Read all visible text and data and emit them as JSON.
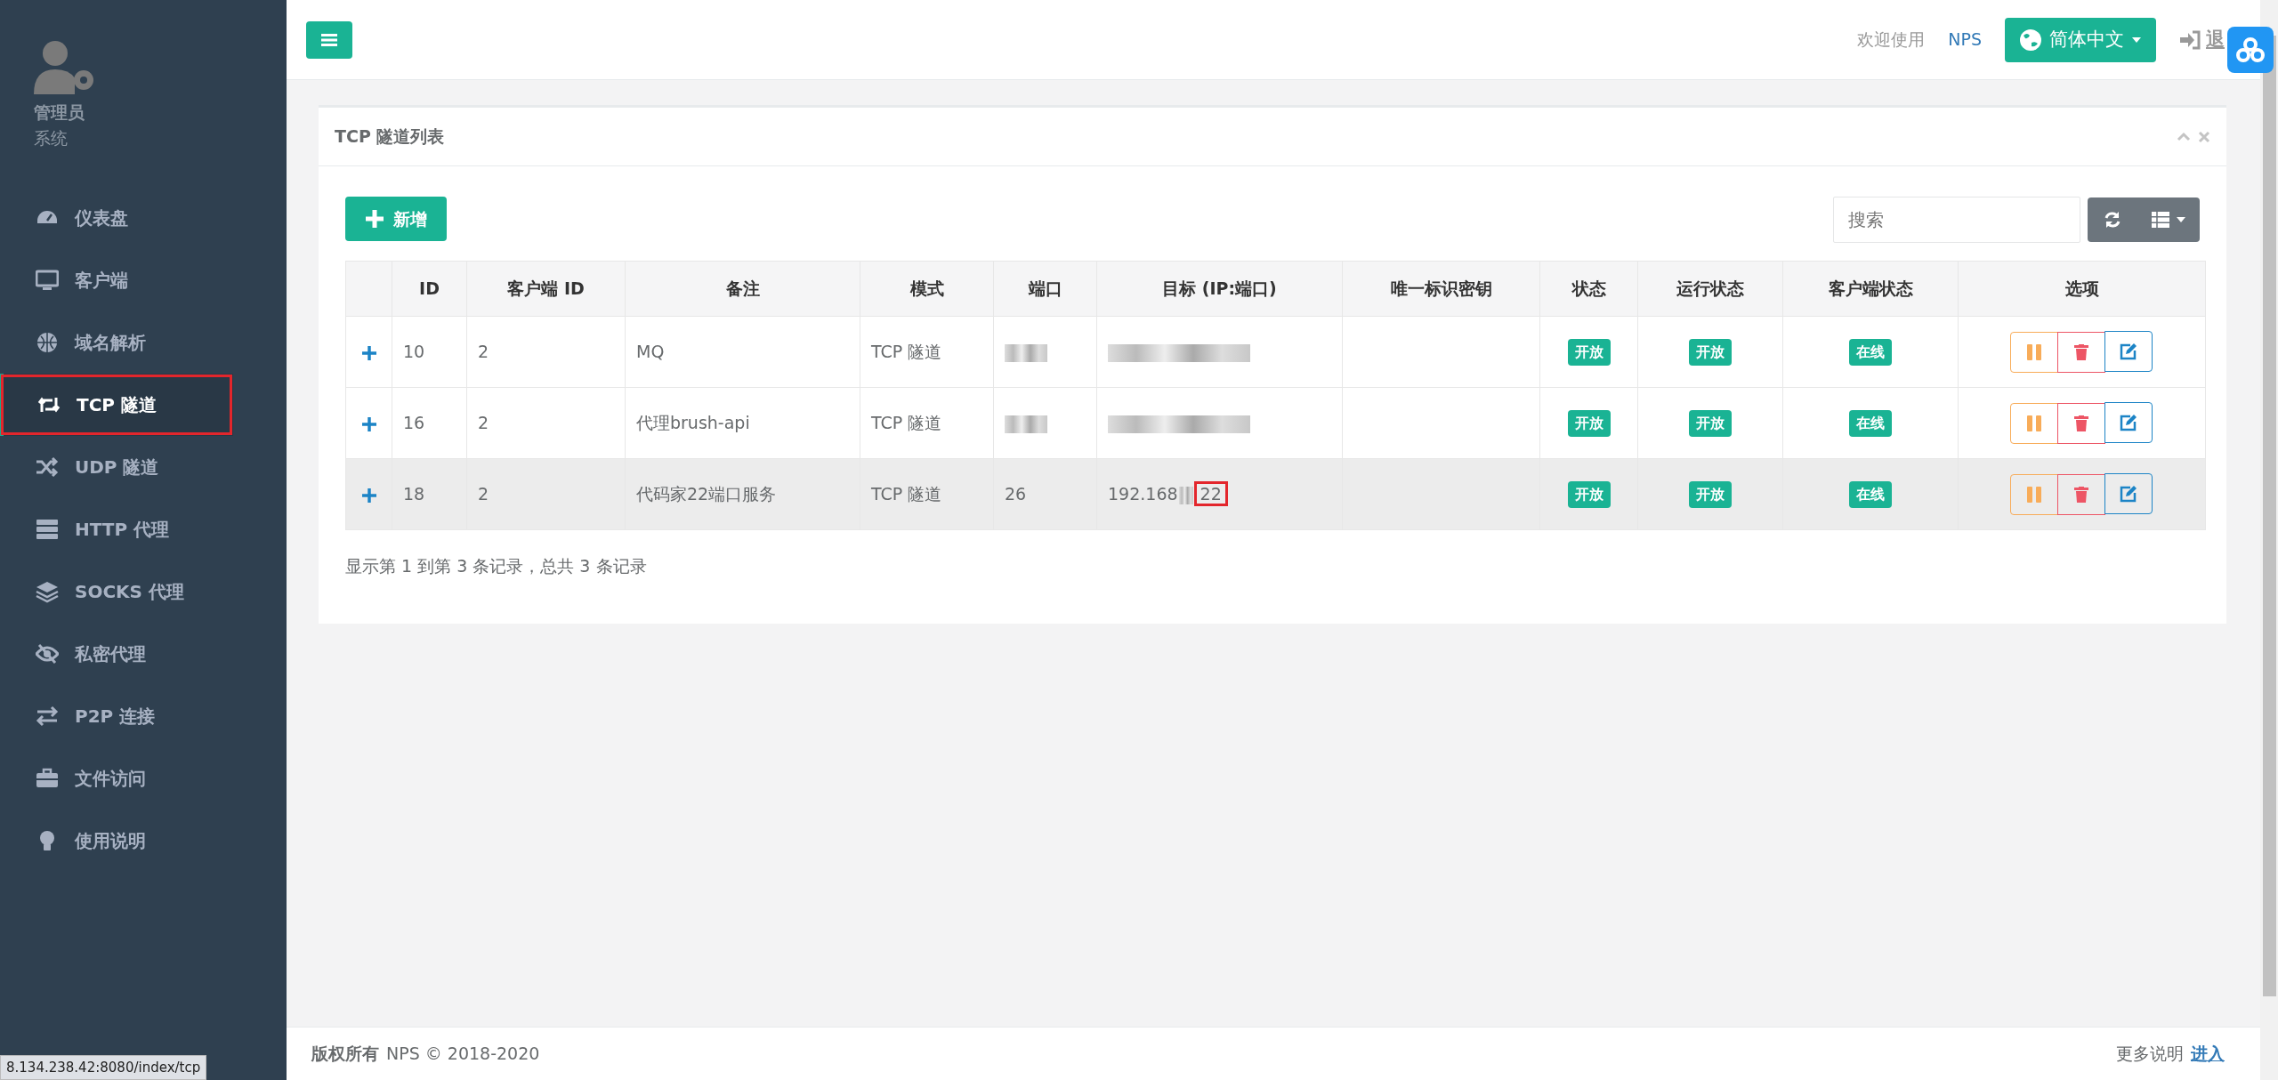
{
  "sidebar": {
    "user": {
      "name": "管理员",
      "role": "系统"
    },
    "items": [
      {
        "label": "仪表盘",
        "selected": false,
        "highlighted": false
      },
      {
        "label": "客户端",
        "selected": false,
        "highlighted": false
      },
      {
        "label": "域名解析",
        "selected": false,
        "highlighted": false
      },
      {
        "label": "TCP 隧道",
        "selected": true,
        "highlighted": true
      },
      {
        "label": "UDP 隧道",
        "selected": false,
        "highlighted": false
      },
      {
        "label": "HTTP 代理",
        "selected": false,
        "highlighted": false
      },
      {
        "label": "SOCKS 代理",
        "selected": false,
        "highlighted": false
      },
      {
        "label": "私密代理",
        "selected": false,
        "highlighted": false
      },
      {
        "label": "P2P 连接",
        "selected": false,
        "highlighted": false
      },
      {
        "label": "文件访问",
        "selected": false,
        "highlighted": false
      },
      {
        "label": "使用说明",
        "selected": false,
        "highlighted": false
      }
    ]
  },
  "header": {
    "welcome": "欢迎使用",
    "brand": "NPS",
    "language": "简体中文",
    "logout": "退"
  },
  "panel": {
    "title": "TCP 隧道列表",
    "add_button": "新增",
    "search": {
      "placeholder": "搜索"
    },
    "table": {
      "columns": [
        "ID",
        "客户端 ID",
        "备注",
        "模式",
        "端口",
        "目标 (IP:端口)",
        "唯一标识密钥",
        "状态",
        "运行状态",
        "客户端状态",
        "选项"
      ],
      "rows": [
        {
          "id": "10",
          "client_id": "2",
          "remark": "MQ",
          "mode": "TCP 隧道",
          "status": "开放",
          "run_status": "开放",
          "client_status": "在线",
          "hovered": false
        },
        {
          "id": "16",
          "client_id": "2",
          "remark": "代理brush-api",
          "mode": "TCP 隧道",
          "status": "开放",
          "run_status": "开放",
          "client_status": "在线",
          "hovered": false
        },
        {
          "id": "18",
          "client_id": "2",
          "remark": "代码家22端口服务",
          "mode": "TCP 隧道",
          "port": "26",
          "target": {
            "prefix": "192.168",
            "suffix": "22",
            "highlighted": true
          },
          "status": "开放",
          "run_status": "开放",
          "client_status": "在线",
          "hovered": true
        }
      ]
    },
    "summary": "显示第 1 到第 3 条记录，总共 3 条记录"
  },
  "footer": {
    "copyright_label": "版权所有",
    "copyright": "NPS © 2018-2020",
    "more": "更多说明",
    "enter": "进入"
  },
  "status_url": "8.134.238.42:8080/index/tcp"
}
